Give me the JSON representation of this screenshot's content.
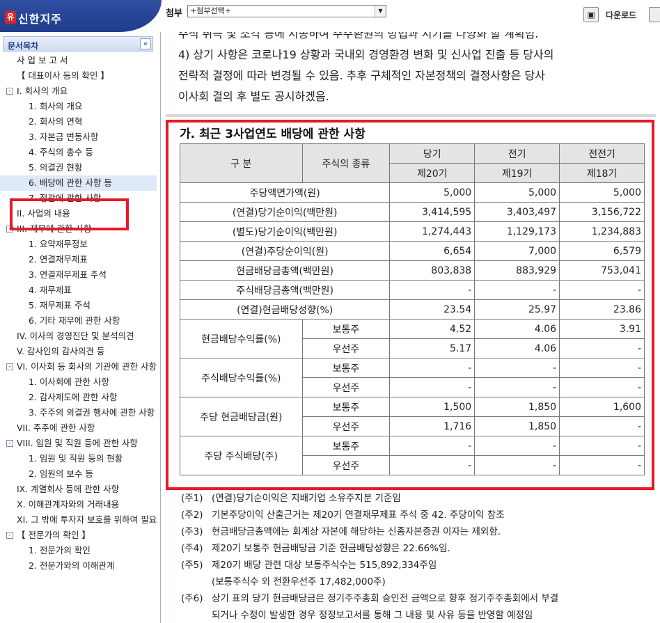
{
  "app": {
    "logo_mark": "유",
    "logo_text": "신한지주",
    "attach_label": "첨부",
    "attach_select": "+첨부선택+",
    "download_label": "다운로드"
  },
  "sidebar": {
    "title": "문서목차",
    "collapse_icon": "«",
    "items": [
      {
        "label": "사 업 보 고 서",
        "level": 0,
        "toggle": ""
      },
      {
        "label": "【 대표이사 등의 확인 】",
        "level": 0,
        "toggle": ""
      },
      {
        "label": "I. 회사의 개요",
        "level": 0,
        "toggle": "-"
      },
      {
        "label": "1. 회사의 개요",
        "level": 1,
        "toggle": ""
      },
      {
        "label": "2. 회사의 연혁",
        "level": 1,
        "toggle": ""
      },
      {
        "label": "3. 자본금 변동사항",
        "level": 1,
        "toggle": ""
      },
      {
        "label": "4. 주식의 총수 등",
        "level": 1,
        "toggle": ""
      },
      {
        "label": "5. 의결권 현황",
        "level": 1,
        "toggle": ""
      },
      {
        "label": "6. 배당에 관한 사항 등",
        "level": 1,
        "toggle": "",
        "selected": true
      },
      {
        "label": "7. 정관에 관한 사항",
        "level": 1,
        "toggle": ""
      },
      {
        "label": "II. 사업의 내용",
        "level": 0,
        "toggle": ""
      },
      {
        "label": "III. 재무에 관한 사항",
        "level": 0,
        "toggle": "-"
      },
      {
        "label": "1. 요약재무정보",
        "level": 1,
        "toggle": ""
      },
      {
        "label": "2. 연결재무제표",
        "level": 1,
        "toggle": ""
      },
      {
        "label": "3. 연결재무제표 주석",
        "level": 1,
        "toggle": ""
      },
      {
        "label": "4. 재무제표",
        "level": 1,
        "toggle": ""
      },
      {
        "label": "5. 재무제표 주석",
        "level": 1,
        "toggle": ""
      },
      {
        "label": "6. 기타 재무에 관한 사항",
        "level": 1,
        "toggle": ""
      },
      {
        "label": "IV. 이사의 경영진단 및 분석의견",
        "level": 0,
        "toggle": ""
      },
      {
        "label": "V. 감사인의 감사의견 등",
        "level": 0,
        "toggle": ""
      },
      {
        "label": "VI. 이사회 등 회사의 기관에 관한 사항",
        "level": 0,
        "toggle": "-"
      },
      {
        "label": "1. 이사회에 관한 사항",
        "level": 1,
        "toggle": ""
      },
      {
        "label": "2. 감사제도에 관한 사항",
        "level": 1,
        "toggle": ""
      },
      {
        "label": "3. 주주의 의결권 행사에 관한 사항",
        "level": 1,
        "toggle": ""
      },
      {
        "label": "VII. 주주에 관한 사항",
        "level": 0,
        "toggle": ""
      },
      {
        "label": "VIII. 임원 및 직원 등에 관한 사항",
        "level": 0,
        "toggle": "-"
      },
      {
        "label": "1. 임원 및 직원 등의 현황",
        "level": 1,
        "toggle": ""
      },
      {
        "label": "2. 임원의 보수 등",
        "level": 1,
        "toggle": ""
      },
      {
        "label": "IX. 계열회사 등에 관한 사항",
        "level": 0,
        "toggle": ""
      },
      {
        "label": "X. 이해관계자와의 거래내용",
        "level": 0,
        "toggle": ""
      },
      {
        "label": "XI. 그 밖에 투자자 보호를 위하여 필요한 사항",
        "level": 0,
        "toggle": ""
      },
      {
        "label": "【 전문가의 확인 】",
        "level": 0,
        "toggle": "-"
      },
      {
        "label": "1. 전문가의 확인",
        "level": 1,
        "toggle": ""
      },
      {
        "label": "2. 전문가와의 이해관계",
        "level": 1,
        "toggle": ""
      }
    ]
  },
  "main": {
    "intro_lines": [
      "주식 취득 및 소각 등에 지송하여 주주환원의 방법과 시기를 다양화 할 계획임.",
      "4) 상기 사항은 코로나19 상황과 국내외 경영환경 변화 및 신사업 진출 등 당사의",
      "전략적 결정에 따라 변경될 수 있음. 추후 구체적인 자본정책의 결정사항은 당사",
      "이사회 결의 후 별도 공시하겠음."
    ],
    "section_title": "가. 최근 3사업연도 배당에 관한 사항",
    "table": {
      "header": {
        "col_category": "구    분",
        "col_stock_type": "주식의 종류",
        "periods": [
          "당기",
          "전기",
          "전전기"
        ],
        "terms": [
          "제20기",
          "제19기",
          "제18기"
        ]
      },
      "simple_rows": [
        {
          "label": "주당액면가액(원)",
          "values": [
            "5,000",
            "5,000",
            "5,000"
          ]
        },
        {
          "label": "(연결)당기순이익(백만원)",
          "values": [
            "3,414,595",
            "3,403,497",
            "3,156,722"
          ]
        },
        {
          "label": "(별도)당기순이익(백만원)",
          "values": [
            "1,274,443",
            "1,129,173",
            "1,234,883"
          ]
        },
        {
          "label": "(연결)주당순이익(원)",
          "values": [
            "6,654",
            "7,000",
            "6,579"
          ]
        },
        {
          "label": "현금배당금총액(백만원)",
          "values": [
            "803,838",
            "883,929",
            "753,041"
          ]
        },
        {
          "label": "주식배당금총액(백만원)",
          "values": [
            "-",
            "-",
            "-"
          ]
        },
        {
          "label": "(연결)현금배당성향(%)",
          "values": [
            "23.54",
            "25.97",
            "23.86"
          ]
        }
      ],
      "grouped_rows": [
        {
          "label": "현금배당수익률(%)",
          "rows": [
            {
              "type": "보통주",
              "values": [
                "4.52",
                "4.06",
                "3.91"
              ]
            },
            {
              "type": "우선주",
              "values": [
                "5.17",
                "4.06",
                "-"
              ]
            }
          ]
        },
        {
          "label": "주식배당수익률(%)",
          "rows": [
            {
              "type": "보통주",
              "values": [
                "-",
                "-",
                "-"
              ]
            },
            {
              "type": "우선주",
              "values": [
                "-",
                "-",
                "-"
              ]
            }
          ]
        },
        {
          "label": "주당 현금배당금(원)",
          "rows": [
            {
              "type": "보통주",
              "values": [
                "1,500",
                "1,850",
                "1,600"
              ]
            },
            {
              "type": "우선주",
              "values": [
                "1,716",
                "1,850",
                "-"
              ]
            }
          ]
        },
        {
          "label": "주당 주식배당(주)",
          "rows": [
            {
              "type": "보통주",
              "values": [
                "-",
                "-",
                "-"
              ]
            },
            {
              "type": "우선주",
              "values": [
                "-",
                "-",
                "-"
              ]
            }
          ]
        }
      ]
    },
    "notes": [
      {
        "label": "(주1)",
        "text": "(연결)당기순이익은 지배기업 소유주지분 기준임"
      },
      {
        "label": "(주2)",
        "text": "기본주당이익 산출근거는 제20기 연결재무제표 주석 중 42. 주당이익 참조"
      },
      {
        "label": "(주3)",
        "text": "현금배당금총액에는 회계상 자본에 해당하는 신종자본증권 이자는 제외함."
      },
      {
        "label": "(주4)",
        "text": "제20기 보통주 현금배당금 기준 현금배당성향은 22.66%임."
      },
      {
        "label": "(주5)",
        "text": "제20기 배당 관련 대상 보통주식수는  515,892,334주임",
        "text2": "(보통주식수 외 전환우선주 17,482,000주)"
      },
      {
        "label": "(주6)",
        "text": "상기 표의 당기 현금배당금은 정기주주총회 승인전 금액으로 향후 정기주주총회에서 부결",
        "text2": "되거나 수정이 발생한 경우 정정보고서를 통해 그 내용 및 사유 등을 반영할 예정임"
      }
    ]
  }
}
